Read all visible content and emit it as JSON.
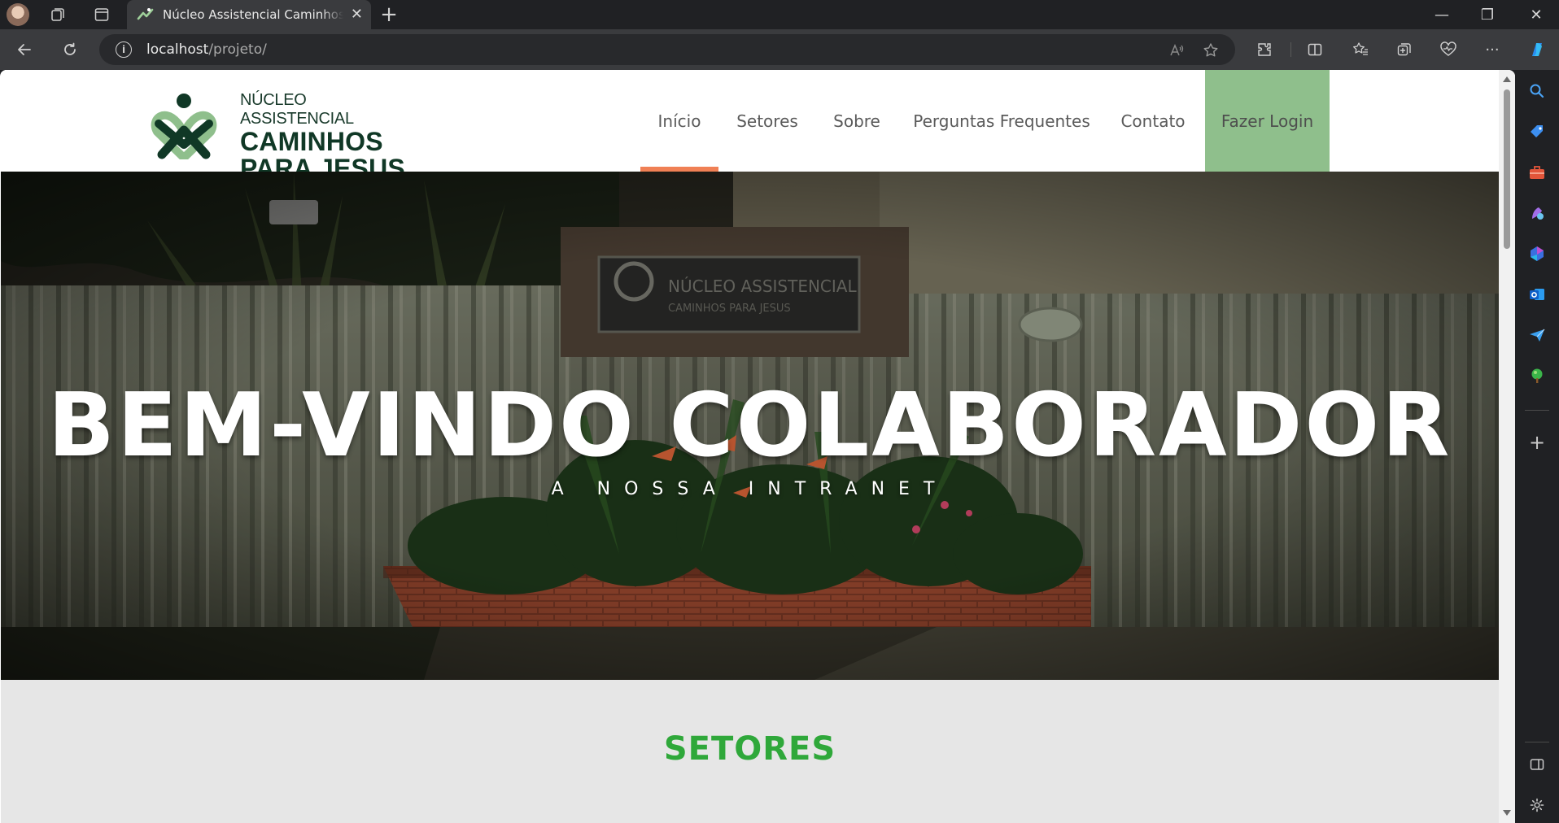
{
  "browser": {
    "tab_title": "Núcleo Assistencial Caminhos para Jesus",
    "url_host": "localhost",
    "url_path": "/projeto/",
    "new_tab_symbol": "+",
    "close_tab_symbol": "✕",
    "window_controls": {
      "minimize": "—",
      "restore": "❐",
      "close": "✕"
    }
  },
  "site": {
    "logo": {
      "line1": "NÚCLEO ASSISTENCIAL",
      "line2": "CAMINHOS",
      "line3": "PARA JESUS"
    },
    "nav": [
      {
        "label": "Início",
        "active": true
      },
      {
        "label": "Setores",
        "active": false
      },
      {
        "label": "Sobre",
        "active": false
      },
      {
        "label": "Perguntas Frequentes",
        "active": false
      },
      {
        "label": "Contato",
        "active": false
      },
      {
        "label": "Fazer Login",
        "active": false
      }
    ],
    "hero": {
      "title": "BEM-VINDO COLABORADOR",
      "subtitle": "A NOSSA INTRANET"
    },
    "setores": {
      "title": "SETORES"
    }
  },
  "colors": {
    "nav_active_underline": "#f08055",
    "login_bg": "#8fbf8c",
    "setores_title": "#2fa83a",
    "logo_dark_green": "#103826",
    "logo_light_green": "#8fbf8c"
  },
  "icons": {
    "toolbar": [
      "back-icon",
      "refresh-icon",
      "info-icon",
      "read-aloud-icon",
      "favorite-star-icon",
      "extensions-icon",
      "split-screen-icon",
      "favorites-icon",
      "collections-icon",
      "browser-essentials-icon",
      "more-icon",
      "copilot-icon"
    ],
    "sidebar": [
      "search-icon",
      "shopping-tag-icon",
      "tools-icon",
      "games-icon",
      "microsoft365-icon",
      "outlook-icon",
      "send-icon",
      "tree-icon",
      "add-icon",
      "sidebar-toggle-icon",
      "settings-icon"
    ]
  }
}
